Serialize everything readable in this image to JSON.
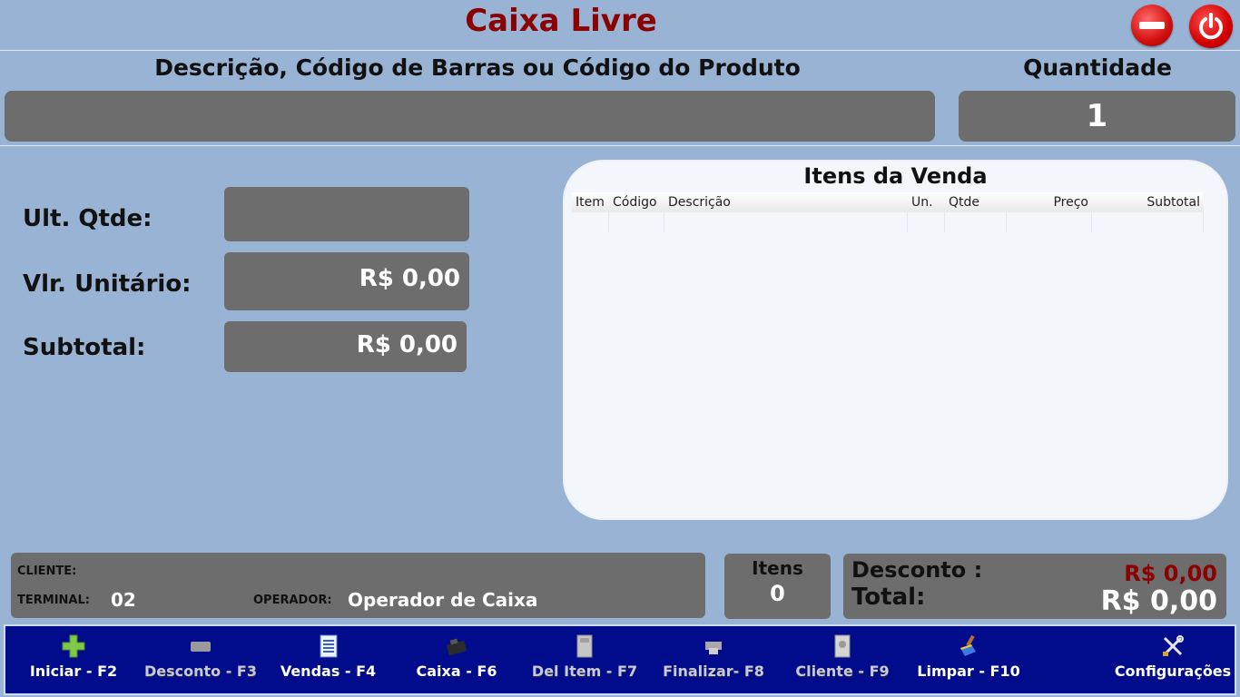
{
  "header": {
    "title": "Caixa Livre"
  },
  "entry": {
    "desc_label": "Descrição, Código de Barras ou Código do Produto",
    "desc_value": "",
    "qty_label": "Quantidade",
    "qty_value": "1"
  },
  "details": {
    "ult_qtde_label": "Ult. Qtde:",
    "ult_qtde_value": "",
    "vlr_unit_label": "Vlr. Unitário:",
    "vlr_unit_value": "R$ 0,00",
    "subtotal_label": "Subtotal:",
    "subtotal_value": "R$ 0,00"
  },
  "items_grid": {
    "title": "Itens da Venda",
    "columns": [
      "Item",
      "Código",
      "Descrição",
      "Un.",
      "Qtde",
      "Preço",
      "Subtotal"
    ],
    "rows": []
  },
  "client": {
    "cliente_label": "CLIENTE:",
    "cliente_value": "",
    "terminal_label": "TERMINAL:",
    "terminal_value": "02",
    "operador_label": "OPERADOR:",
    "operador_value": "Operador de Caixa"
  },
  "summary": {
    "itens_label": "Itens",
    "itens_value": "0",
    "desconto_label": "Desconto :",
    "desconto_value": "R$ 0,00",
    "total_label": "Total:",
    "total_value": "R$ 0,00",
    "desconto_color": "#8b0000"
  },
  "toolbar": {
    "iniciar": "Iniciar - F2",
    "desconto": "Desconto - F3",
    "vendas": "Vendas - F4",
    "caixa": "Caixa - F6",
    "del_item": "Del Item - F7",
    "finalizar": "Finalizar- F8",
    "cliente": "Cliente - F9",
    "limpar": "Limpar - F10",
    "configuracoes": "Configurações"
  },
  "colors": {
    "background": "#98b3d3",
    "panel": "#6d6d6d",
    "title": "#8b0000",
    "toolbar": "#000c8c"
  }
}
